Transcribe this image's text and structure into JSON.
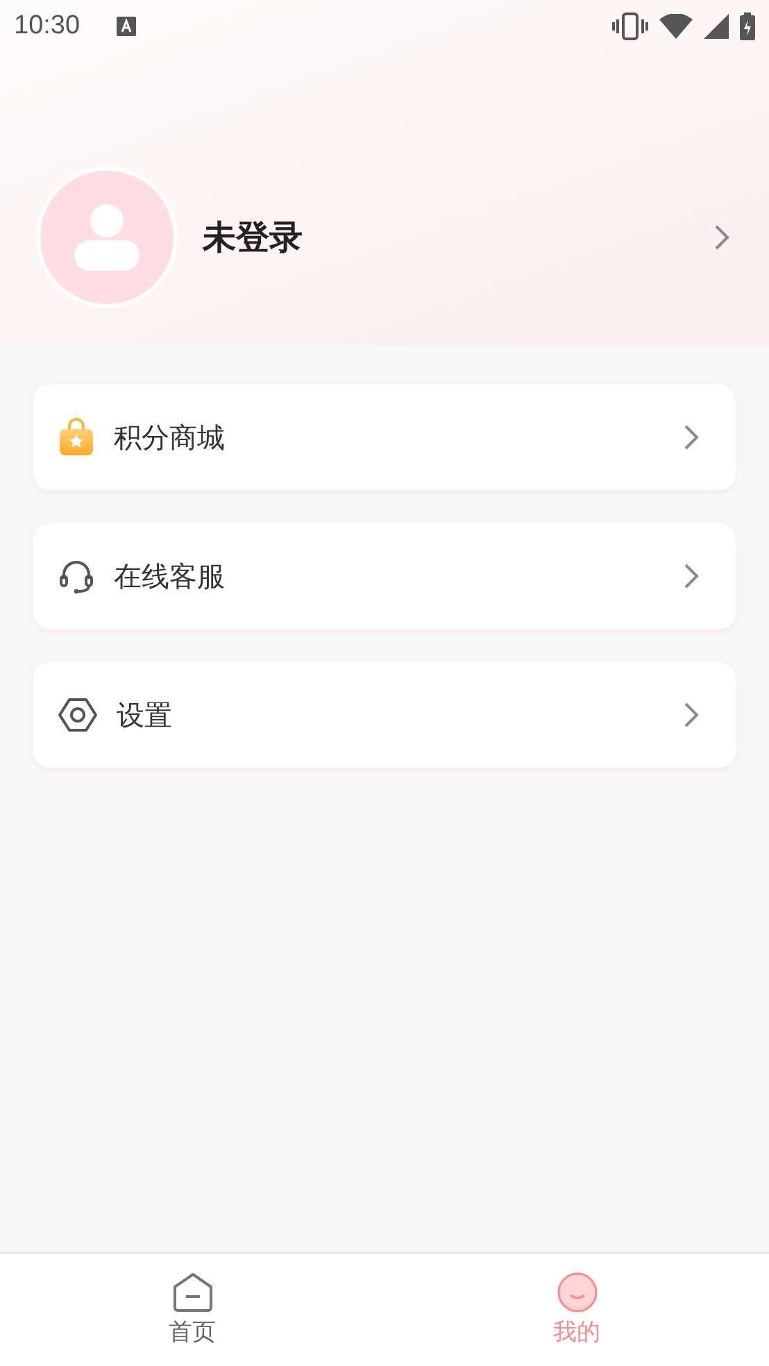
{
  "status_bar": {
    "time": "10:30"
  },
  "profile": {
    "name": "未登录"
  },
  "menu": [
    {
      "kind": "shop",
      "label": "积分商城"
    },
    {
      "kind": "service",
      "label": "在线客服"
    },
    {
      "kind": "settings",
      "label": "设置"
    }
  ],
  "tabs": [
    {
      "kind": "home",
      "label": "首页",
      "selected": false
    },
    {
      "kind": "mine",
      "label": "我的",
      "selected": true
    }
  ]
}
